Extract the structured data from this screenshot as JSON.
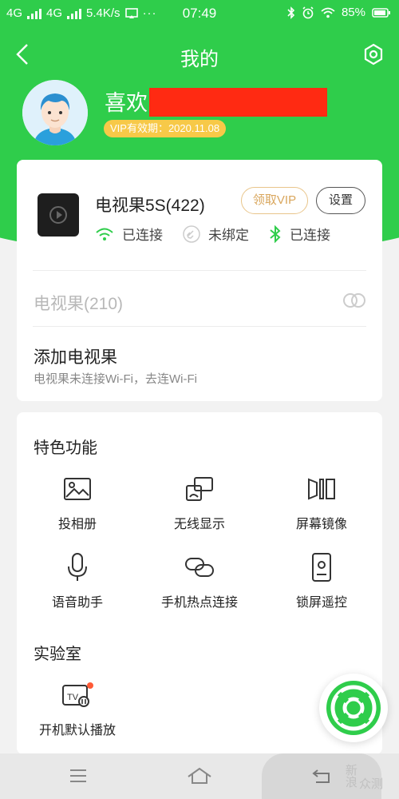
{
  "status_bar": {
    "network1": "4G",
    "network2": "4G",
    "speed": "5.4K/s",
    "time": "07:49",
    "battery": "85%"
  },
  "header": {
    "title": "我的"
  },
  "profile": {
    "name": "喜欢",
    "vip_expiry": "VIP有效期：2020.11.08"
  },
  "device_card": {
    "name": "电视果5S(422)",
    "vip_button": "领取VIP",
    "settings_button": "设置",
    "status": [
      {
        "label": "已连接",
        "icon": "wifi-icon"
      },
      {
        "label": "未绑定",
        "icon": "link-icon"
      },
      {
        "label": "已连接",
        "icon": "bluetooth-icon"
      }
    ],
    "other_device": "电视果(210)",
    "add_title": "添加电视果",
    "add_subtitle": "电视果未连接Wi-Fi，去连Wi-Fi"
  },
  "features": {
    "title": "特色功能",
    "items": [
      {
        "label": "投相册",
        "icon": "photo-icon"
      },
      {
        "label": "无线显示",
        "icon": "cast-icon"
      },
      {
        "label": "屏幕镜像",
        "icon": "mirror-icon"
      },
      {
        "label": "语音助手",
        "icon": "microphone-icon"
      },
      {
        "label": "手机热点连接",
        "icon": "hotspot-link-icon"
      },
      {
        "label": "锁屏遥控",
        "icon": "lockscreen-remote-icon"
      }
    ]
  },
  "lab": {
    "title": "实验室",
    "items": [
      {
        "label": "开机默认播放",
        "icon": "tv-autoplay-icon"
      }
    ]
  },
  "colors": {
    "primary_green": "#2fcd4b",
    "vip_gold": "#f7c948",
    "redaction": "#ff2a12"
  },
  "watermark": {
    "line1": "新浪",
    "line2": "众测"
  }
}
